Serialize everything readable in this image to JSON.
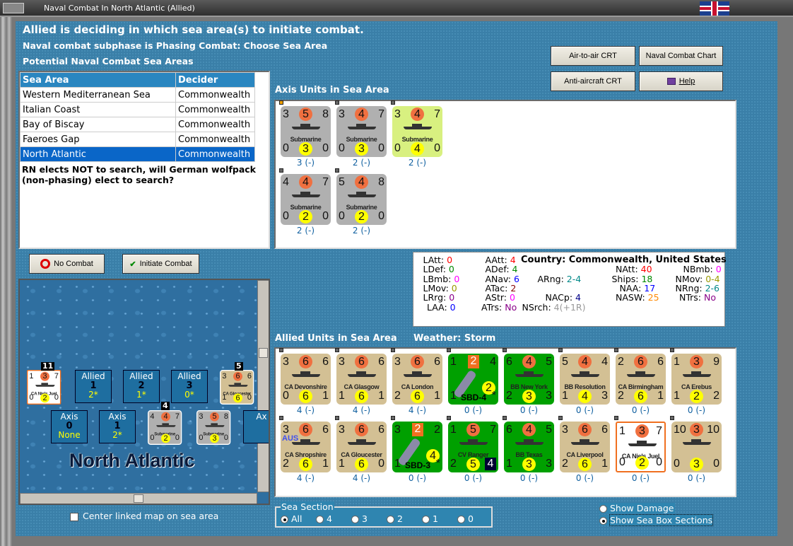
{
  "window": {
    "title": "Naval Combat In North Atlantic (Allied)"
  },
  "header": {
    "line1": "Allied is deciding in which sea area(s) to initiate combat.",
    "line2": "Naval combat subphase is Phasing Combat: Choose Sea Area",
    "line3": "Potential Naval Combat Sea Areas"
  },
  "toolbar": {
    "air_to_air": "Air-to-air CRT",
    "naval_chart": "Naval Combat Chart",
    "anti_aircraft": "Anti-aircraft CRT",
    "help": "Help"
  },
  "sea_table": {
    "headers": [
      "Sea Area",
      "Decider"
    ],
    "rows": [
      [
        "Western Mediterranean Sea",
        "Commonwealth"
      ],
      [
        "Italian Coast",
        "Commonwealth"
      ],
      [
        "Bay of Biscay",
        "Commonwealth"
      ],
      [
        "Faeroes Gap",
        "Commonwealth"
      ],
      [
        "North Atlantic",
        "Commonwealth"
      ]
    ],
    "selected": 4,
    "message": "RN elects NOT to search, will German wolfpack (non-phasing) elect to search?"
  },
  "actions": {
    "no_combat": "No Combat",
    "initiate_combat": "Initiate Combat"
  },
  "axis_panel": {
    "title": "Axis Units in Sea Area"
  },
  "allied_panel": {
    "title": "Allied Units in Sea Area",
    "weather": "Weather:  Storm"
  },
  "colors": {
    "tan": "#d3c094",
    "grey": "#b0b0b0",
    "lime": "#d8f080",
    "green": "#00a000",
    "white": "#ffffff"
  },
  "axis_units": [
    {
      "name": "Submarine",
      "type": "sub",
      "bg": "grey",
      "top": [
        "3",
        "5",
        "8"
      ],
      "bot": [
        "0",
        "3",
        "0"
      ],
      "status": "3",
      "mod": "(-)",
      "marker": "orange"
    },
    {
      "name": "Submarine",
      "type": "sub",
      "bg": "grey",
      "top": [
        "3",
        "4",
        "7"
      ],
      "bot": [
        "0",
        "3",
        "0"
      ],
      "status": "2",
      "mod": "(-)"
    },
    {
      "name": "Submarine",
      "type": "sub",
      "bg": "lime",
      "top": [
        "3",
        "4",
        "7"
      ],
      "bot": [
        "0",
        "4",
        "0"
      ],
      "status": "2",
      "mod": "(-)"
    },
    {
      "name": "Submarine",
      "type": "sub",
      "bg": "grey",
      "top": [
        "4",
        "4",
        "7"
      ],
      "bot": [
        "0",
        "2",
        "0"
      ],
      "status": "2",
      "mod": "(-)"
    },
    {
      "name": "Submarine",
      "type": "sub",
      "bg": "grey",
      "top": [
        "5",
        "4",
        "8"
      ],
      "bot": [
        "0",
        "2",
        "0"
      ],
      "status": "2",
      "mod": "(-)"
    }
  ],
  "allied_units": [
    {
      "name": "CA Devonshire",
      "bg": "tan",
      "top": [
        "3",
        "6",
        "6"
      ],
      "bot": [
        "0",
        "6",
        "1"
      ],
      "status": "4",
      "mod": "(-)"
    },
    {
      "name": "CA Glasgow",
      "bg": "tan",
      "top": [
        "3",
        "6",
        "6"
      ],
      "bot": [
        "1",
        "6",
        "1"
      ],
      "status": "4",
      "mod": "(-)"
    },
    {
      "name": "CA London",
      "bg": "tan",
      "top": [
        "3",
        "6",
        "6"
      ],
      "bot": [
        "2",
        "6",
        "1"
      ],
      "status": "4",
      "mod": "(-)"
    },
    {
      "name": "SBD-4",
      "type": "plane",
      "bg": "green",
      "top": [
        "1",
        "2",
        "4"
      ],
      "bot": [
        "1",
        "2",
        ""
      ],
      "status": "0",
      "mod": "(-)"
    },
    {
      "name": "BB New York",
      "bg": "green",
      "top": [
        "6",
        "4",
        "5"
      ],
      "bot": [
        "2",
        "3",
        "3"
      ],
      "status": "0",
      "mod": "(-)"
    },
    {
      "name": "BB Resolution",
      "bg": "tan",
      "top": [
        "5",
        "4",
        "4"
      ],
      "bot": [
        "1",
        "4",
        "3"
      ],
      "status": "0",
      "mod": "(-)"
    },
    {
      "name": "CA Birmingham",
      "bg": "tan",
      "top": [
        "2",
        "6",
        "6"
      ],
      "bot": [
        "2",
        "6",
        "1"
      ],
      "status": "0",
      "mod": "(-)"
    },
    {
      "name": "CA Erebus",
      "bg": "tan",
      "top": [
        "1",
        "3",
        "9"
      ],
      "bot": [
        "1",
        "2",
        "2"
      ],
      "status": "0",
      "mod": "(-)"
    },
    {
      "name": "CA Shropshire",
      "bg": "tan",
      "top": [
        "3",
        "6",
        "6"
      ],
      "bot": [
        "2",
        "6",
        "1"
      ],
      "status": "4",
      "mod": "(-)",
      "nation": "AUS"
    },
    {
      "name": "CA Gloucester",
      "bg": "tan",
      "top": [
        "3",
        "6",
        "6"
      ],
      "bot": [
        "1",
        "6",
        "0"
      ],
      "status": "4",
      "mod": "(-)"
    },
    {
      "name": "SBD-3",
      "type": "plane",
      "bg": "green",
      "top": [
        "3",
        "2",
        "2"
      ],
      "bot": [
        "1",
        "4",
        ""
      ],
      "status": "0",
      "mod": "(-)"
    },
    {
      "name": "CV Ranger",
      "bg": "green",
      "top": [
        "1",
        "5",
        "7"
      ],
      "bot": [
        "2",
        "5",
        "4"
      ],
      "status": "0",
      "mod": "(-)",
      "carrier": true
    },
    {
      "name": "BB Texas",
      "bg": "green",
      "top": [
        "6",
        "4",
        "5"
      ],
      "bot": [
        "1",
        "3",
        "3"
      ],
      "status": "0",
      "mod": "(-)"
    },
    {
      "name": "CA Liverpool",
      "bg": "tan",
      "top": [
        "3",
        "6",
        "6"
      ],
      "bot": [
        "2",
        "6",
        "1"
      ],
      "status": "0",
      "mod": "(-)"
    },
    {
      "name": "CA Niels Juel",
      "bg": "white",
      "top": [
        "1",
        "3",
        "7"
      ],
      "bot": [
        "0",
        "2",
        "0"
      ],
      "status": "0",
      "mod": "(-)"
    },
    {
      "name": "",
      "bg": "tan",
      "top": [
        "10",
        "3",
        "10"
      ],
      "bot": [
        "0",
        "3",
        "0"
      ],
      "status": "0",
      "mod": "(-)"
    }
  ],
  "stats": {
    "country_label": "Country: Commonwealth, United States",
    "items": [
      [
        "LAtt:",
        "0",
        "#f00"
      ],
      [
        "LDef:",
        "0",
        "#080"
      ],
      [
        "LBmb:",
        "0",
        "#f0f"
      ],
      [
        "LMov:",
        "0",
        "#990"
      ],
      [
        "LRrg:",
        "0",
        "#808"
      ],
      [
        "LAA:",
        "0",
        "#00f"
      ],
      [
        "AAtt:",
        "4",
        "#f00"
      ],
      [
        "ADef:",
        "4",
        "#080"
      ],
      [
        "ANav:",
        "6",
        "#00f"
      ],
      [
        "ATac:",
        "2",
        "#800"
      ],
      [
        "AStr:",
        "0",
        "#f0f"
      ],
      [
        "ATrs:",
        "No",
        "#808"
      ],
      [
        "ARng:",
        "2-4",
        "#088"
      ],
      [
        "NACp:",
        "4",
        "#008"
      ],
      [
        "NSrch:",
        "4(+1R)",
        "#999"
      ],
      [
        "NAtt:",
        "40",
        "#f00"
      ],
      [
        "Ships:",
        "18",
        "#080"
      ],
      [
        "NAA:",
        "17",
        "#00f"
      ],
      [
        "NASW:",
        "25",
        "#f80"
      ],
      [
        "NBmb:",
        "0",
        "#f0f"
      ],
      [
        "NMov:",
        "0-4",
        "#990"
      ],
      [
        "NRng:",
        "2-6",
        "#088"
      ],
      [
        "NTrs:",
        "No",
        "#808"
      ]
    ]
  },
  "map": {
    "sea_name": "North Atlantic",
    "allied_boxes": [
      {
        "label": "Allied",
        "num": "1",
        "val": "2*"
      },
      {
        "label": "Allied",
        "num": "2",
        "val": "1*"
      },
      {
        "label": "Allied",
        "num": "3",
        "val": "0*"
      }
    ],
    "axis_boxes": [
      {
        "label": "Axis",
        "num": "0",
        "val": "None"
      },
      {
        "label": "Axis",
        "num": "1",
        "val": "2*"
      },
      {
        "label": "Ax",
        "num": "",
        "val": ""
      }
    ],
    "badges": [
      "11",
      "5",
      "4"
    ],
    "counters": [
      {
        "name": "CA Niels Juel",
        "top": [
          "1",
          "3",
          "7"
        ],
        "bot": [
          "0",
          "2",
          "0"
        ],
        "bg": "white"
      },
      {
        "name": "CA Gloucester",
        "top": [
          "3",
          "6",
          "6"
        ],
        "bot": [
          "1",
          "6",
          "0"
        ],
        "bg": "tan"
      },
      {
        "name": "Submarine",
        "top": [
          "4",
          "4",
          "7"
        ],
        "bot": [
          "0",
          "2",
          "0"
        ],
        "bg": "grey"
      },
      {
        "name": "Submarine",
        "top": [
          "3",
          "5",
          "8"
        ],
        "bot": [
          "0",
          "3",
          "0"
        ],
        "bg": "grey"
      }
    ],
    "center_checkbox": "Center linked map on sea area"
  },
  "sea_section": {
    "legend": "Sea Section",
    "options": [
      "All",
      "4",
      "3",
      "2",
      "1",
      "0"
    ],
    "selected": 0
  },
  "display": {
    "show_damage": "Show Damage",
    "show_sections": "Show Sea Box Sections"
  }
}
